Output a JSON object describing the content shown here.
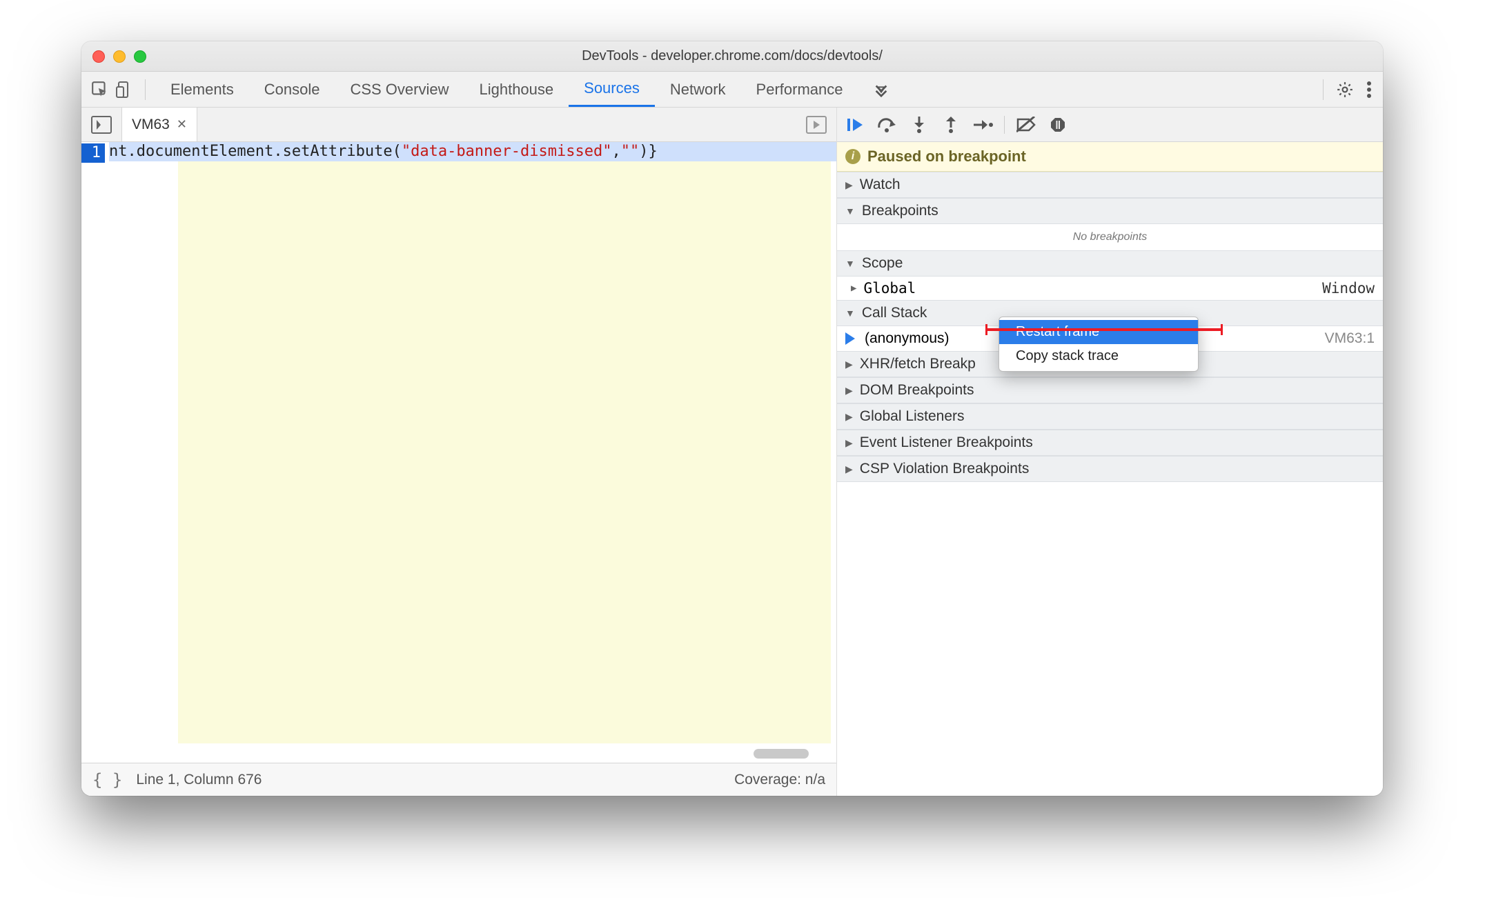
{
  "window_title": "DevTools - developer.chrome.com/docs/devtools/",
  "tabs": {
    "elements": "Elements",
    "console": "Console",
    "css_overview": "CSS Overview",
    "lighthouse": "Lighthouse",
    "sources": "Sources",
    "network": "Network",
    "performance": "Performance"
  },
  "file_tab": {
    "name": "VM63"
  },
  "code": {
    "line_number": "1",
    "seg1": "nt.documentElement.setAttribute(",
    "seg2": "\"data-banner-dismissed\"",
    "seg3": ",",
    "seg4": "\"\"",
    "seg5": ")}"
  },
  "status": {
    "position": "Line 1, Column 676",
    "coverage": "Coverage: n/a"
  },
  "paused": "Paused on breakpoint",
  "sections": {
    "watch": "Watch",
    "breakpoints": "Breakpoints",
    "no_breakpoints": "No breakpoints",
    "scope": "Scope",
    "global": "Global",
    "window": "Window",
    "call_stack": "Call Stack",
    "anon": "(anonymous)",
    "anon_loc": "VM63:1",
    "xhr": "XHR/fetch Breakp",
    "dom_bp": "DOM Breakpoints",
    "global_listeners": "Global Listeners",
    "event_bp": "Event Listener Breakpoints",
    "csp_bp": "CSP Violation Breakpoints"
  },
  "ctx": {
    "restart": "Restart frame",
    "copy": "Copy stack trace"
  }
}
